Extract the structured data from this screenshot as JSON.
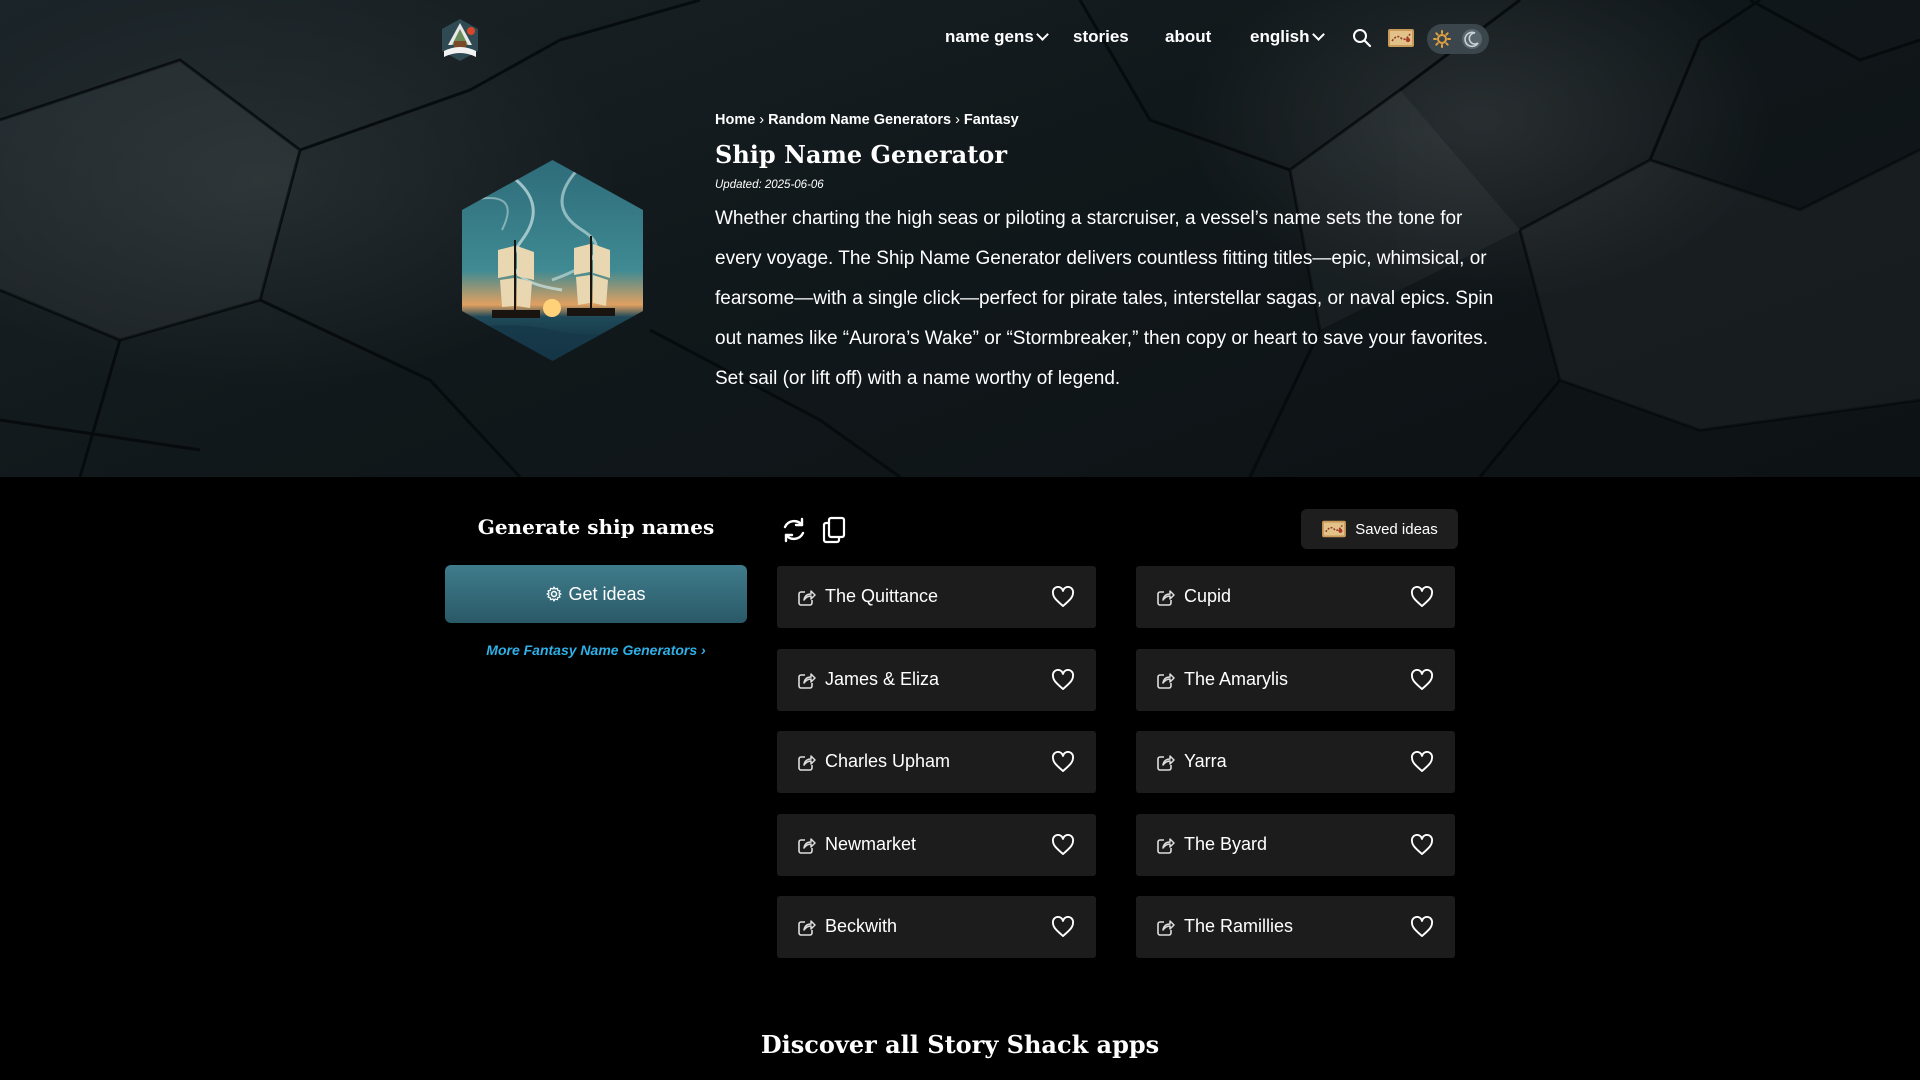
{
  "nav": {
    "name_gens": "name gens",
    "stories": "stories",
    "about": "about",
    "language": "english"
  },
  "breadcrumb": {
    "home": "Home",
    "random": "Random Name Generators",
    "fantasy": "Fantasy",
    "separator": "›"
  },
  "page": {
    "title": "Ship Name Generator",
    "updated": "Updated: 2025-06-06",
    "intro": "Whether charting the high seas or piloting a starcruiser, a vessel’s name sets the tone for every voyage. The Ship Name Generator delivers countless fitting titles—epic, whimsical, or fearsome—with a single click—perfect for pirate tales, interstellar sagas, or naval epics. Spin out names like “Aurora’s Wake” or “Stormbreaker,” then copy or heart to save your favorites. Set sail (or lift off) with a name worthy of legend."
  },
  "generator": {
    "heading": "Generate ship names",
    "get_ideas": "Get ideas",
    "more_link": "More Fantasy Name Generators ›",
    "saved_ideas": "Saved ideas",
    "names_left": [
      "The Quittance",
      "James & Eliza",
      "Charles Upham",
      "Newmarket",
      "Beckwith"
    ],
    "names_right": [
      "Cupid",
      "The Amarylis",
      "Yarra",
      "The Byard",
      "The Ramillies"
    ]
  },
  "footer": {
    "discover": "Discover all Story Shack apps"
  },
  "colors": {
    "accent_button": "#3f7c8c",
    "link": "#2fb0e6",
    "card_bg": "#1c1c1c",
    "theme_sun": "#e0a040"
  }
}
